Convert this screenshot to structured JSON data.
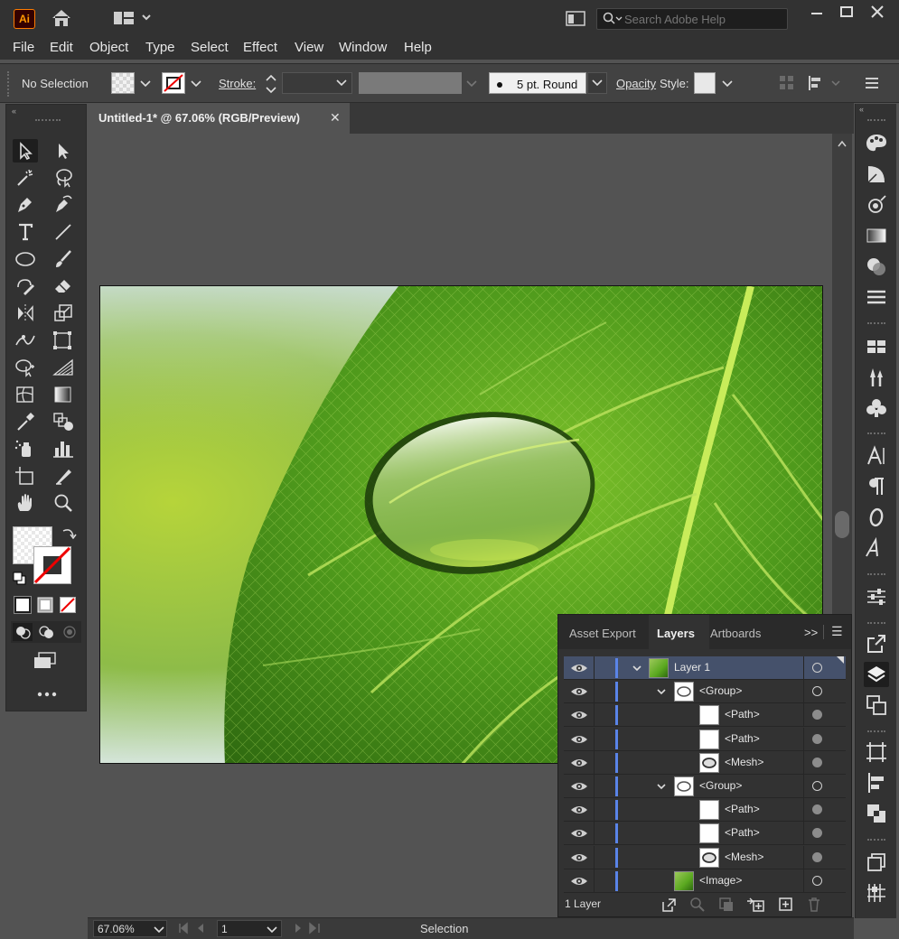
{
  "app": {
    "logo_text": "Ai"
  },
  "help_search": {
    "placeholder": "Search Adobe Help"
  },
  "menu": [
    "File",
    "Edit",
    "Object",
    "Type",
    "Select",
    "Effect",
    "View",
    "Window",
    "Help"
  ],
  "control_bar": {
    "selection_label": "No Selection",
    "stroke_label": "Stroke:",
    "brush_label": "5 pt. Round",
    "opacity_label": "Opacity",
    "style_label": "Style:"
  },
  "document": {
    "tab_title": "Untitled-1* @ 67.06% (RGB/Preview)",
    "close_glyph": "✕"
  },
  "status_bar": {
    "zoom": "67.06%",
    "artboard_number": "1",
    "status": "Selection"
  },
  "layers_panel": {
    "tabs": [
      "Asset Export",
      "Layers",
      "Artboards"
    ],
    "active_tab": "Layers",
    "overflow_glyph": ">>",
    "menu_glyph": "☰",
    "rows": [
      {
        "name": "Layer 1",
        "level": 0,
        "expanded": true,
        "selected": true,
        "thumb": "leaf",
        "target_filled": false
      },
      {
        "name": "<Group>",
        "level": 1,
        "expanded": true,
        "selected": false,
        "thumb": "drop",
        "target_filled": false
      },
      {
        "name": "<Path>",
        "level": 2,
        "expanded": false,
        "selected": false,
        "thumb": "white",
        "target_filled": true
      },
      {
        "name": "<Path>",
        "level": 2,
        "expanded": false,
        "selected": false,
        "thumb": "white",
        "target_filled": true
      },
      {
        "name": "<Mesh>",
        "level": 2,
        "expanded": false,
        "selected": false,
        "thumb": "mesh",
        "target_filled": true
      },
      {
        "name": "<Group>",
        "level": 1,
        "expanded": true,
        "selected": false,
        "thumb": "drop",
        "target_filled": false
      },
      {
        "name": "<Path>",
        "level": 2,
        "expanded": false,
        "selected": false,
        "thumb": "white",
        "target_filled": true
      },
      {
        "name": "<Path>",
        "level": 2,
        "expanded": false,
        "selected": false,
        "thumb": "white",
        "target_filled": true
      },
      {
        "name": "<Mesh>",
        "level": 2,
        "expanded": false,
        "selected": false,
        "thumb": "mesh",
        "target_filled": true
      },
      {
        "name": "<Image>",
        "level": 1,
        "expanded": false,
        "selected": false,
        "thumb": "leaf",
        "target_filled": false
      }
    ],
    "footer_count": "1 Layer"
  },
  "colors": {
    "accent_blue": "#5a84e8",
    "selected_row": "#45516b",
    "ui_dark": "#323232",
    "canvas": "#535353",
    "leaf_green": "#5aa820"
  }
}
